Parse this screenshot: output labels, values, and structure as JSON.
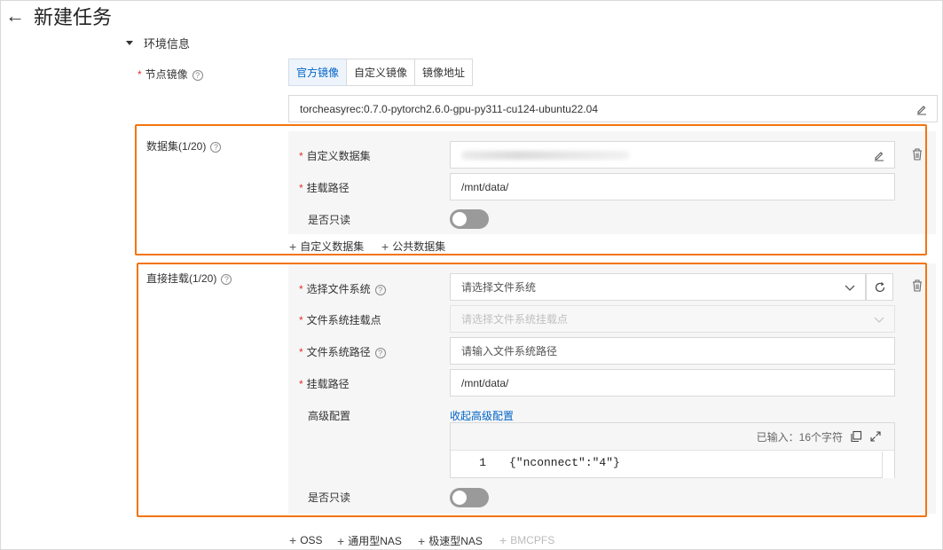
{
  "header": {
    "title": "新建任务"
  },
  "env_section": {
    "title": "环境信息"
  },
  "node_image": {
    "label": "节点镜像",
    "tabs": [
      "官方镜像",
      "自定义镜像",
      "镜像地址"
    ],
    "active_tab": "官方镜像",
    "value": "torcheasyrec:0.7.0-pytorch2.6.0-gpu-py311-cu124-ubuntu22.04"
  },
  "dataset": {
    "title": "数据集(1/20)",
    "custom_dataset_label": "自定义数据集",
    "mount_path_label": "挂载路径",
    "mount_path_value": "/mnt/data/",
    "readonly_label": "是否只读",
    "add_custom": "自定义数据集",
    "add_public": "公共数据集"
  },
  "direct_mount": {
    "title": "直接挂载(1/20)",
    "fs_label": "选择文件系统",
    "fs_placeholder": "请选择文件系统",
    "mountpoint_label": "文件系统挂载点",
    "mountpoint_placeholder": "请选择文件系统挂载点",
    "fs_path_label": "文件系统路径",
    "fs_path_placeholder": "请输入文件系统路径",
    "mount_path_label": "挂载路径",
    "mount_path_value": "/mnt/data/",
    "advanced_label": "高级配置",
    "advanced_toggle_link": "收起高级配置",
    "editor_count": "已输入：16个字符",
    "editor_line_no": "1",
    "editor_code": "{\"nconnect\":\"4\"}",
    "readonly_label": "是否只读"
  },
  "add_mounts": {
    "oss": "OSS",
    "general_nas": "通用型NAS",
    "extreme_nas": "极速型NAS",
    "bmcpfs": "BMCPFS"
  }
}
